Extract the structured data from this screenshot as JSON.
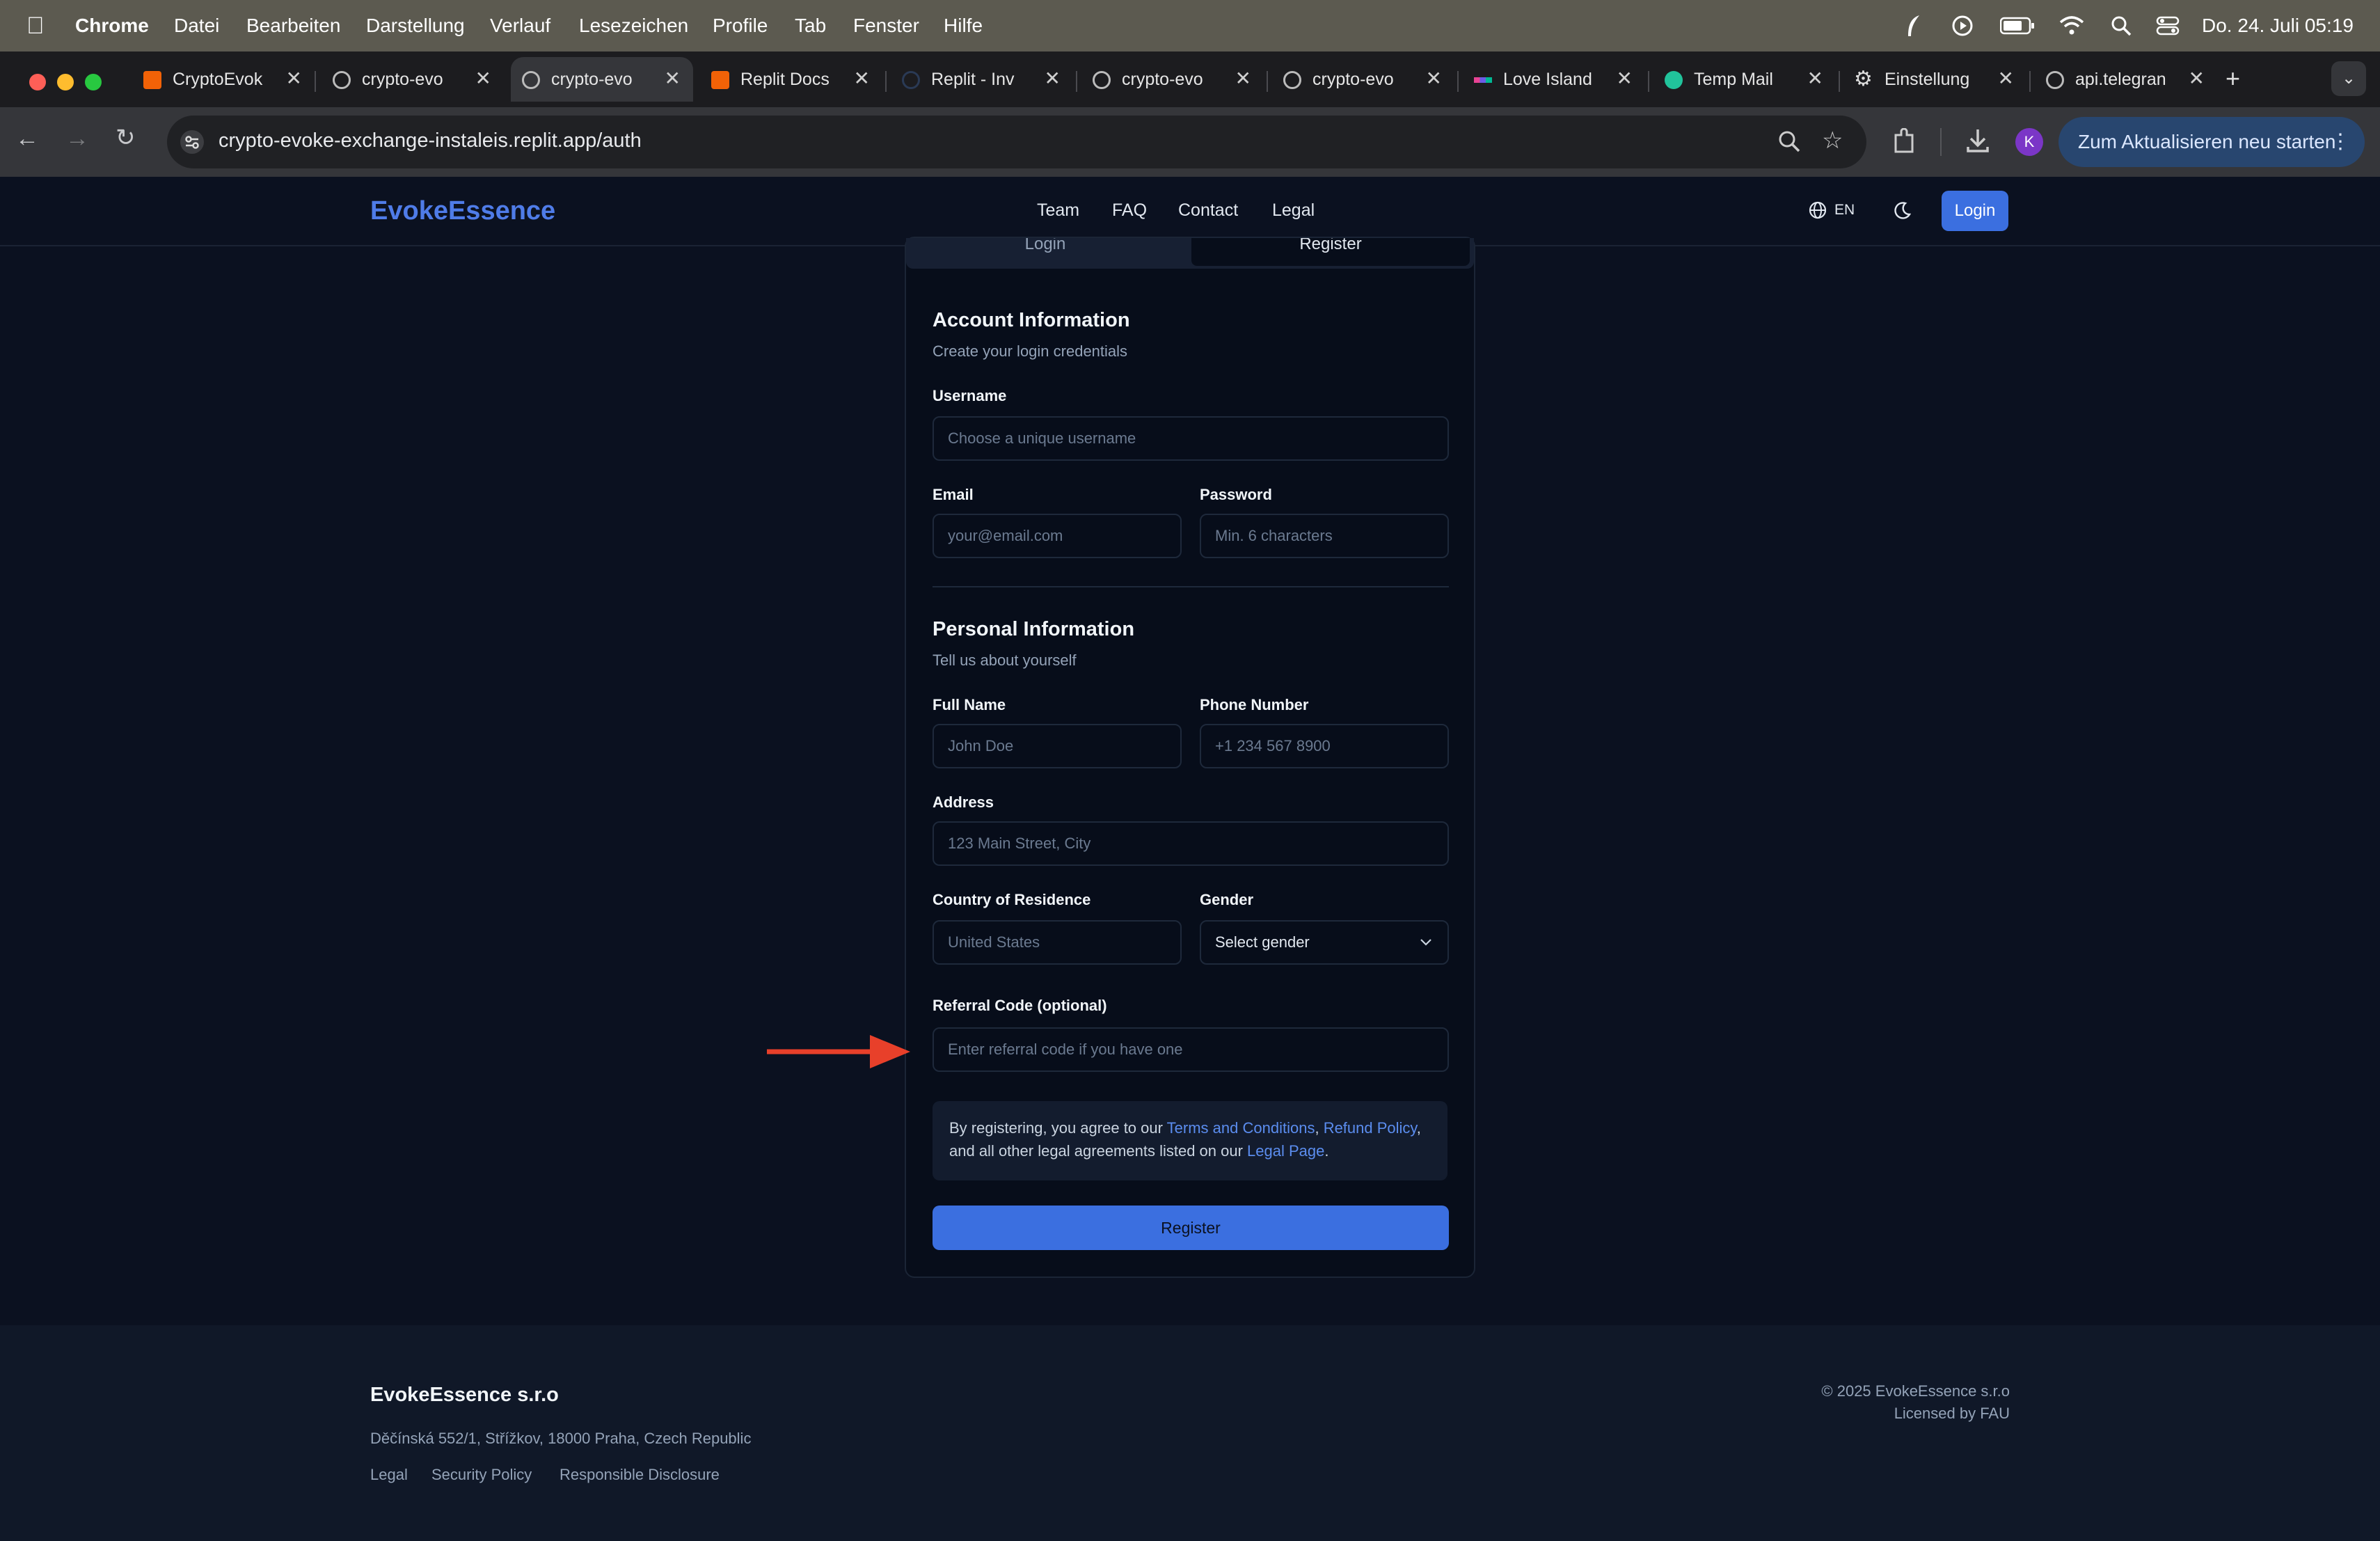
{
  "menubar": {
    "app": "Chrome",
    "items": [
      "Datei",
      "Bearbeiten",
      "Darstellung",
      "Verlauf",
      "Lesezeichen",
      "Profile",
      "Tab",
      "Fenster",
      "Hilfe"
    ],
    "datetime": "Do. 24. Juli  05:19"
  },
  "tabs": [
    {
      "title": "CryptoEvok",
      "fav": "replit-icon"
    },
    {
      "title": "crypto-evo",
      "fav": "globe-icon"
    },
    {
      "title": "crypto-evo",
      "fav": "globe-icon",
      "active": true
    },
    {
      "title": "Replit Docs",
      "fav": "replit-icon"
    },
    {
      "title": "Replit - Inv",
      "fav": "loading-icon"
    },
    {
      "title": "crypto-evo",
      "fav": "globe-icon"
    },
    {
      "title": "crypto-evo",
      "fav": "globe-icon"
    },
    {
      "title": "Love Island",
      "fav": "dots-icon"
    },
    {
      "title": "Temp Mail",
      "fav": "mail-icon"
    },
    {
      "title": "Einstellung",
      "fav": "gear-icon"
    },
    {
      "title": "api.telegran",
      "fav": "globe-icon"
    }
  ],
  "toolbar": {
    "url": "crypto-evoke-exchange-instaleis.replit.app/auth",
    "profile_initial": "K",
    "update_label": "Zum Aktualisieren neu starten"
  },
  "site": {
    "brand": "EvokeEssence",
    "nav": [
      "Team",
      "FAQ",
      "Contact",
      "Legal"
    ],
    "lang": "EN",
    "login_label": "Login"
  },
  "form": {
    "tab_login": "Login",
    "tab_register": "Register",
    "account_title": "Account Information",
    "account_sub": "Create your login credentials",
    "username_label": "Username",
    "username_placeholder": "Choose a unique username",
    "email_label": "Email",
    "email_placeholder": "your@email.com",
    "password_label": "Password",
    "password_placeholder": "Min. 6 characters",
    "personal_title": "Personal Information",
    "personal_sub": "Tell us about yourself",
    "fullname_label": "Full Name",
    "fullname_placeholder": "John Doe",
    "phone_label": "Phone Number",
    "phone_placeholder": "+1 234 567 8900",
    "address_label": "Address",
    "address_placeholder": "123 Main Street, City",
    "country_label": "Country of Residence",
    "country_placeholder": "United States",
    "gender_label": "Gender",
    "gender_value": "Select gender",
    "referral_label": "Referral Code (optional)",
    "referral_placeholder": "Enter referral code if you have one",
    "terms_prefix": "By registering, you agree to our ",
    "terms_link": "Terms and Conditions",
    "terms_comma": ", ",
    "refund_link": "Refund Policy",
    "terms_mid": ", and all other legal agreements listed on our ",
    "legal_link": "Legal Page",
    "terms_end": ".",
    "register_label": "Register"
  },
  "footer": {
    "company": "EvokeEssence s.r.o",
    "address": "Děčínská 552/1, Střížkov, 18000 Praha, Czech Republic",
    "links": [
      "Legal",
      "Security Policy",
      "Responsible Disclosure"
    ],
    "copyright": "© 2025 EvokeEssence s.r.o",
    "license": "Licensed by FAU"
  },
  "colors": {
    "accent": "#3b6fe0",
    "arrow": "#e8402a",
    "background": "#0b1120"
  }
}
